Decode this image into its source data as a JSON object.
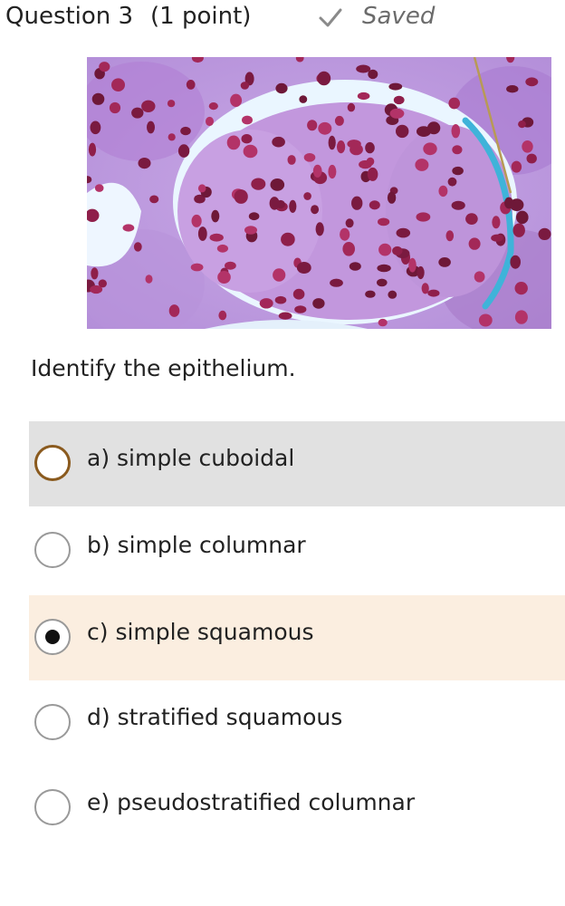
{
  "question": {
    "title": "Question 3",
    "points": "(1 point)",
    "status_icon": "checkmark-icon",
    "status": "Saved"
  },
  "image": {
    "alt": "micrograph-image"
  },
  "prompt": "Identify the epithelium.",
  "options": [
    {
      "label": "a) simple cuboidal",
      "state": "hover"
    },
    {
      "label": "b) simple columnar",
      "state": "default"
    },
    {
      "label": "c) simple squamous",
      "state": "selected"
    },
    {
      "label": "d) stratified squamous",
      "state": "default"
    },
    {
      "label": "e) pseudostratified columnar",
      "state": "default"
    }
  ],
  "colors": {
    "hover_bg": "#e1e1e1",
    "selected_bg": "#fbeee0",
    "hover_ring": "#8a5a1e",
    "saved_gray": "#6b6b6b"
  }
}
